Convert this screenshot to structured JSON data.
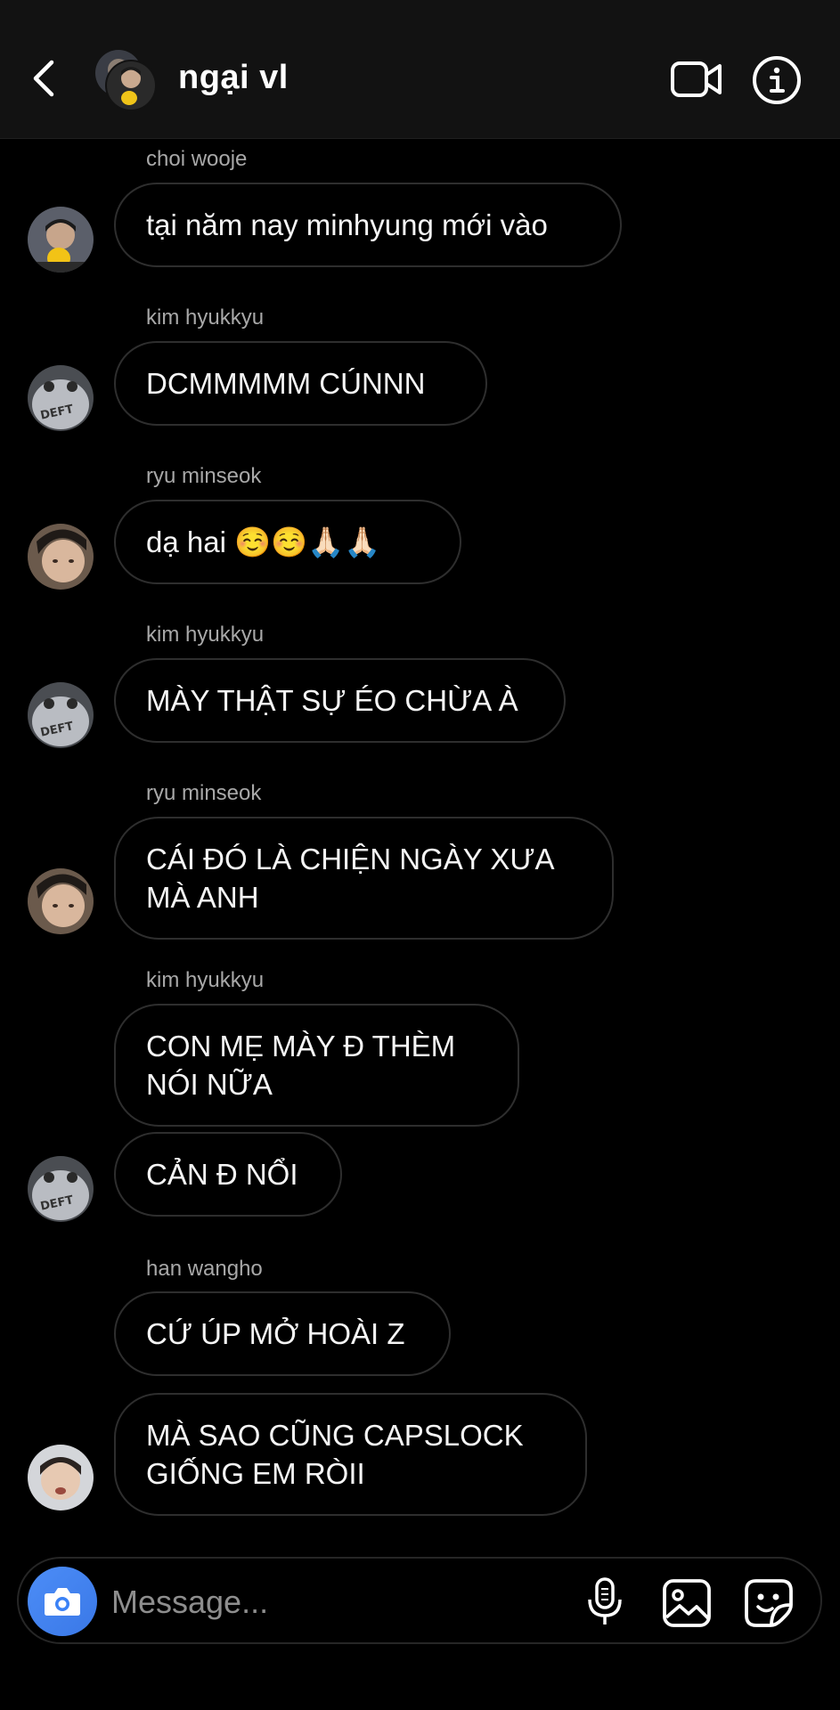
{
  "header": {
    "title": "ngại vl"
  },
  "messages": [
    {
      "sender": "choi wooje",
      "text": "tại năm nay minhyung mới vào"
    },
    {
      "sender": "kim hyukkyu",
      "text": "DCMMMMM CÚNNN"
    },
    {
      "sender": "ryu minseok",
      "text": "dạ hai ☺️☺️🙏🏻🙏🏻"
    },
    {
      "sender": "kim hyukkyu",
      "text": "MÀY THẬT SỰ ÉO CHỪA À"
    },
    {
      "sender": "ryu minseok",
      "text": "CÁI ĐÓ LÀ CHIỆN NGÀY XƯA\nMÀ ANH"
    },
    {
      "sender": "kim hyukkyu",
      "text": "CON MẸ MÀY Đ THÈM\nNÓI NỮA"
    },
    {
      "sender": "",
      "text": "CẢN Đ NỔI"
    },
    {
      "sender": "han wangho",
      "text": "CỨ ÚP MỞ HOÀI Z"
    },
    {
      "sender": "",
      "text": "MÀ SAO CŨNG CAPSLOCK\nGIỐNG EM RÒII"
    }
  ],
  "composer": {
    "placeholder": "Message..."
  },
  "icons": {
    "back": "chevron-left-icon",
    "video": "video-camera-icon",
    "info": "info-icon",
    "camera": "camera-icon",
    "mic": "microphone-icon",
    "gallery": "gallery-icon",
    "sticker": "sticker-icon"
  },
  "colors": {
    "background": "#000000",
    "header": "#121212",
    "bubble_border": "#2e2e2e",
    "camera_button": "#3b82f6",
    "secondary_text": "#a8a8a8"
  }
}
